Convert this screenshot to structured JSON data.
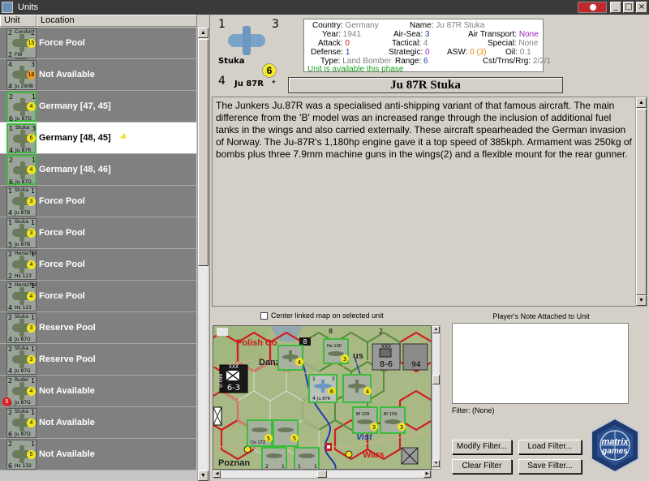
{
  "window": {
    "title": "Units"
  },
  "columns": {
    "unit": "Unit",
    "location": "Location"
  },
  "unit_rows": [
    {
      "top": "2",
      "topname": "Condor",
      "model": "FW 200C",
      "bl": "2",
      "br": "2",
      "badge": "15",
      "badge_color": "yellow",
      "location": "Force Pool"
    },
    {
      "top": "4",
      "topname": "",
      "model": "Ju 290B",
      "bl": "4",
      "br": "3",
      "badge": "18",
      "badge_color": "orange",
      "location": "Not Available"
    },
    {
      "top": "2",
      "topname": "",
      "model": "Ju 87D",
      "bl": "6",
      "br": "1",
      "badge": "4",
      "badge_color": "yellow",
      "location": "Germany [47, 45]"
    },
    {
      "top": "1",
      "topname": "Stuka",
      "model": "Ju 87R",
      "bl": "4",
      "br": "3",
      "badge": "6",
      "badge_color": "yellow",
      "location": "Germany [48, 45]"
    },
    {
      "top": "2",
      "topname": "",
      "model": "Ju 87D",
      "bl": "6",
      "br": "1",
      "badge": "4",
      "badge_color": "yellow",
      "location": "Germany [48, 46]"
    },
    {
      "top": "1",
      "topname": "Stuka",
      "model": "Ju 87B",
      "bl": "4",
      "br": "1",
      "badge": "3",
      "badge_color": "yellow",
      "location": "Force Pool"
    },
    {
      "top": "1",
      "topname": "Stuka",
      "model": "Ju 87B",
      "bl": "5",
      "br": "1",
      "badge": "3",
      "badge_color": "yellow",
      "location": "Force Pool"
    },
    {
      "top": "2",
      "topname": "Henschel",
      "model": "Hs 123",
      "bl": "2",
      "br": "1",
      "badge": "4",
      "badge_color": "yellow",
      "location": "Force Pool"
    },
    {
      "top": "2",
      "topname": "Henschel",
      "model": "Hs 123",
      "bl": "4",
      "br": "1",
      "badge": "4",
      "badge_color": "yellow",
      "location": "Force Pool"
    },
    {
      "top": "2",
      "topname": "Stuka",
      "model": "Ju 87G",
      "bl": "4",
      "br": "1",
      "badge": "3",
      "badge_color": "yellow",
      "location": "Reserve Pool"
    },
    {
      "top": "2",
      "topname": "Stuka",
      "model": "Ju 87G",
      "bl": "4",
      "br": "1",
      "badge": "3",
      "badge_color": "yellow",
      "location": "Reserve Pool"
    },
    {
      "top": "2",
      "topname": "Rudel",
      "model": "Ju 87G",
      "bl": "5",
      "br": "1",
      "badge": "4",
      "badge_color": "yellow",
      "location": "Not Available"
    },
    {
      "top": "2",
      "topname": "Stuka",
      "model": "Ju 87D",
      "bl": "6",
      "br": "1",
      "badge": "4",
      "badge_color": "yellow",
      "location": "Not Available"
    },
    {
      "top": "2",
      "topname": "",
      "model": "Hs 132",
      "bl": "6",
      "br": "1",
      "badge": "5",
      "badge_color": "yellow",
      "location": "Not Available"
    }
  ],
  "selected_counter": {
    "tl": "1",
    "tr": "3",
    "bl": "4",
    "name": "Stuka",
    "model": "Ju 87R",
    "badge": "6",
    "star": "*"
  },
  "stats": {
    "country_label": "Country:",
    "country": "Germany",
    "name_label": "Name:",
    "name": "Ju 87R Stuka",
    "air_transport_label": "Air Transport:",
    "air_transport": "None",
    "year_label": "Year:",
    "year": "1941",
    "air_sea_label": "Air-Sea:",
    "air_sea": "3",
    "special_label": "Special:",
    "special": "None",
    "attack_label": "Attack:",
    "attack": "0",
    "tactical_label": "Tactical:",
    "tactical": "4",
    "oil_label": "Oil:",
    "oil": "0.1",
    "defense_label": "Defense:",
    "defense": "1",
    "strategic_label": "Strategic:",
    "strategic": "0",
    "asw_label": "ASW:",
    "asw": "0 (3)",
    "cst_label": "Cst/Trns/Rrg:",
    "cst": "2/2/1",
    "type_label": "Type:",
    "type": "Land Bomber",
    "range_label": "Range:",
    "range": "6",
    "availability": "Unit is available this phase"
  },
  "unit_title": "Ju 87R Stuka",
  "description": "The Junkers Ju.87R was a specialised anti-shipping variant of that famous aircraft. The main difference from the 'B' model was an increased range through the inclusion of additional fuel tanks in the wings and also carried externally. These aircraft spearheaded the German invasion of Norway. The Ju-87R's 1,180hp engine gave it a top speed of 385kph. Armament was 250kg of bombs plus three 7.9mm machine guns in the wings(2) and a flexible mount for the rear gunner.",
  "map": {
    "center_label": "Center linked map on selected unit",
    "labels": {
      "polish": "Polish Co",
      "danz": "Danz",
      "us": "us",
      "vist": "Vist",
      "wars": "Wars",
      "poznan": "Poznan"
    },
    "counters": {
      "corps_val": "6-3",
      "corps_top": "XXX",
      "corps_side": "VI ENN",
      "inf_top": "XXX",
      "inf_val": "8-6",
      "stuka_model": "Ju 87R",
      "stuka_tl": "1",
      "stuka_tr": "3",
      "stuka_b": "4",
      "stuka_badge": "6",
      "he111": "He 100",
      "bf109a": "Bf 109",
      "bf109b": "Bf 109",
      "do17": "Do 17Z",
      "c1": "3",
      "c2": "4",
      "c3": "3",
      "c4": "4",
      "c5": "5",
      "c6": "1",
      "c7": "2",
      "c8": "5",
      "c9": "1",
      "c10": "1",
      "c11": "3",
      "c12": "4",
      "c13": "8",
      "c14": "2",
      "c15": "94"
    }
  },
  "notes": {
    "label": "Player's Note Attached to Unit",
    "filter": "Filter: (None)"
  },
  "buttons": {
    "modify": "Modify Filter...",
    "load": "Load Filter...",
    "clear": "Clear Filter",
    "save": "Save Filter..."
  },
  "logo": {
    "line1": "matrix",
    "line2": "games"
  },
  "colors": {
    "stack_border": "#3cbc3c",
    "badge": "#f3e51c",
    "hex_border": "#d02020"
  }
}
